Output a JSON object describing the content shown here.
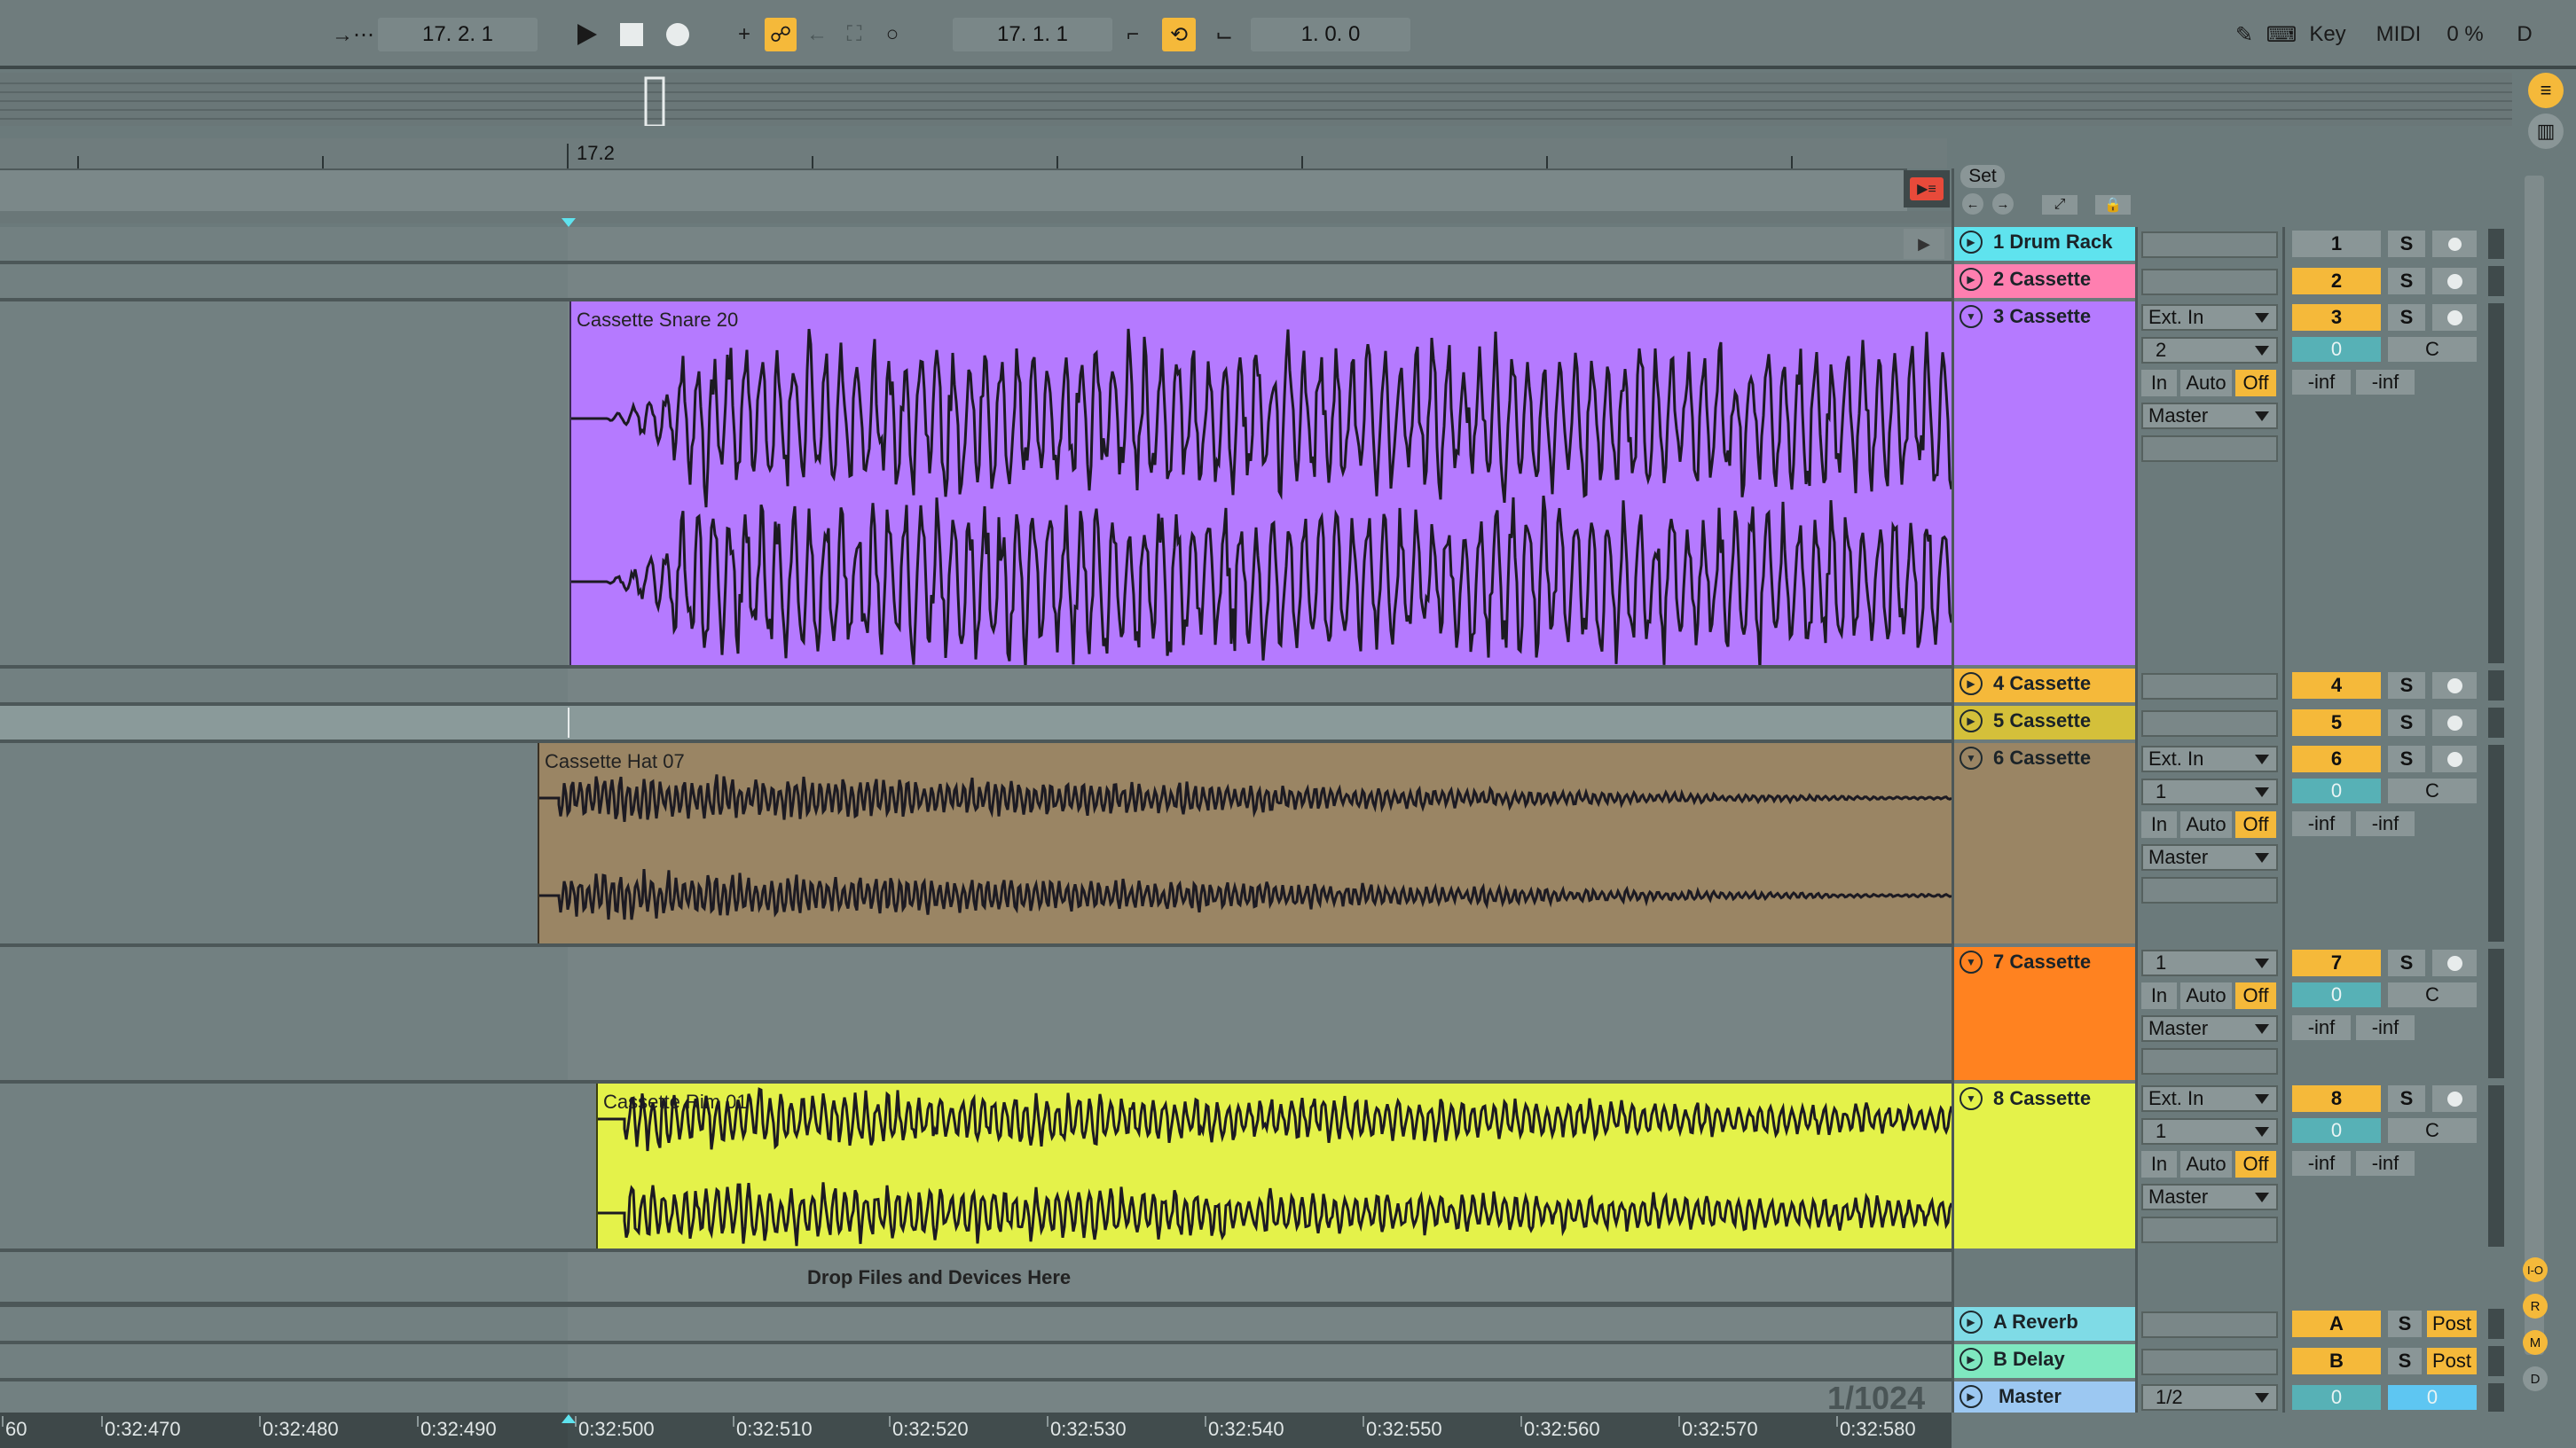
{
  "transport": {
    "arrangement_position": "17.  2.  1",
    "loop_start": "17.  1.  1",
    "loop_length": "1.  0.  0",
    "key_label": "Key",
    "midi_label": "MIDI",
    "cpu_load": "0 %",
    "d_label": "D"
  },
  "ruler": {
    "marker": "17.2"
  },
  "set": {
    "label": "Set"
  },
  "tracks": [
    {
      "name": "1 Drum Rack",
      "number": "1",
      "color": "#5fe3ee"
    },
    {
      "name": "2 Cassette",
      "number": "2",
      "color": "#ff7fb0"
    },
    {
      "name": "3 Cassette",
      "number": "3",
      "color": "#b57aff",
      "input": "Ext. In",
      "channel": "2",
      "monitor": [
        "In",
        "Auto",
        "Off"
      ],
      "output": "Master",
      "volume": "0",
      "pan": "C",
      "peak_l": "-inf",
      "peak_r": "-inf"
    },
    {
      "name": "4 Cassette",
      "number": "4",
      "color": "#f5b93a"
    },
    {
      "name": "5 Cassette",
      "number": "5",
      "color": "#d4c03a"
    },
    {
      "name": "6 Cassette",
      "number": "6",
      "color": "#9a8564",
      "input": "Ext. In",
      "channel": "1",
      "monitor": [
        "In",
        "Auto",
        "Off"
      ],
      "output": "Master",
      "volume": "0",
      "pan": "C",
      "peak_l": "-inf",
      "peak_r": "-inf"
    },
    {
      "name": "7 Cassette",
      "number": "7",
      "color": "#ff8220",
      "channel": "1",
      "monitor": [
        "In",
        "Auto",
        "Off"
      ],
      "output": "Master",
      "volume": "0",
      "pan": "C",
      "peak_l": "-inf",
      "peak_r": "-inf"
    },
    {
      "name": "8 Cassette",
      "number": "8",
      "color": "#e4f24a",
      "input": "Ext. In",
      "channel": "1",
      "monitor": [
        "In",
        "Auto",
        "Off"
      ],
      "output": "Master",
      "volume": "0",
      "pan": "C",
      "peak_l": "-inf",
      "peak_r": "-inf"
    }
  ],
  "clips": [
    {
      "name": "Cassette Snare 20",
      "color": "#b57aff"
    },
    {
      "name": "Cassette Hat 07",
      "color": "#9a8564"
    },
    {
      "name": "Cassette Rim 01",
      "color": "#e4f24a"
    }
  ],
  "drop_hint": "Drop Files and Devices Here",
  "returns": [
    {
      "name": "A Reverb",
      "letter": "A",
      "color": "#7fdbe6",
      "post": "Post"
    },
    {
      "name": "B Delay",
      "letter": "B",
      "color": "#7fe8c0",
      "post": "Post"
    }
  ],
  "master": {
    "name": "Master",
    "color": "#9cc8f2",
    "output": "1/2",
    "volume": "0",
    "cue": "0"
  },
  "grid_quantization": "1/1024",
  "time_ruler": [
    "60",
    "0:32:470",
    "0:32:480",
    "0:32:490",
    "0:32:500",
    "0:32:510",
    "0:32:520",
    "0:32:530",
    "0:32:540",
    "0:32:550",
    "0:32:560",
    "0:32:570",
    "0:32:580"
  ],
  "side_buttons": [
    "I-O",
    "R",
    "M",
    "D"
  ]
}
